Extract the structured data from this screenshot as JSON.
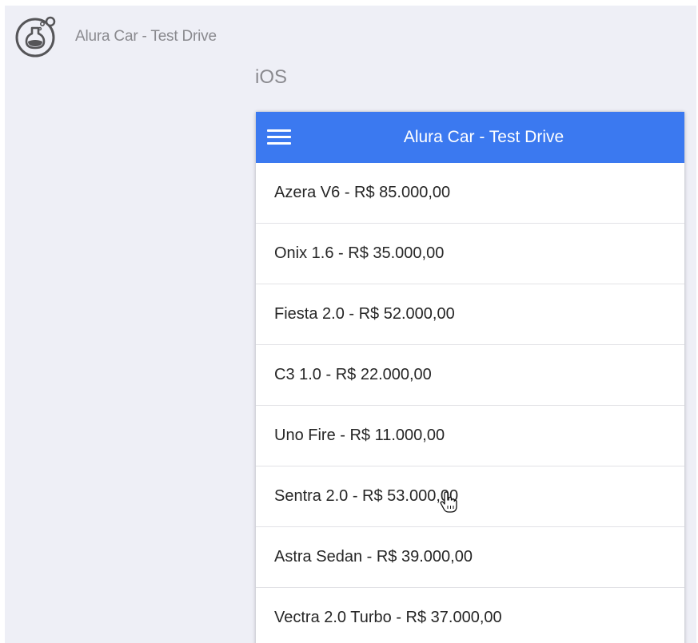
{
  "header": {
    "logo_icon": "flask-icon",
    "app_title": "Alura Car - Test Drive",
    "platform": "iOS"
  },
  "device": {
    "navbar": {
      "menu_icon": "hamburger-menu-icon",
      "title": "Alura Car - Test Drive",
      "color": "#3b79f0"
    },
    "cars": [
      "Azera V6 - R$ 85.000,00",
      "Onix 1.6 - R$ 35.000,00",
      "Fiesta 2.0 - R$ 52.000,00",
      "C3 1.0 - R$ 22.000,00",
      "Uno Fire - R$ 11.000,00",
      "Sentra 2.0 - R$ 53.000,00",
      "Astra Sedan - R$ 39.000,00",
      "Vectra 2.0 Turbo - R$ 37.000,00"
    ]
  },
  "cursor_icon": "hand-pointer-icon"
}
